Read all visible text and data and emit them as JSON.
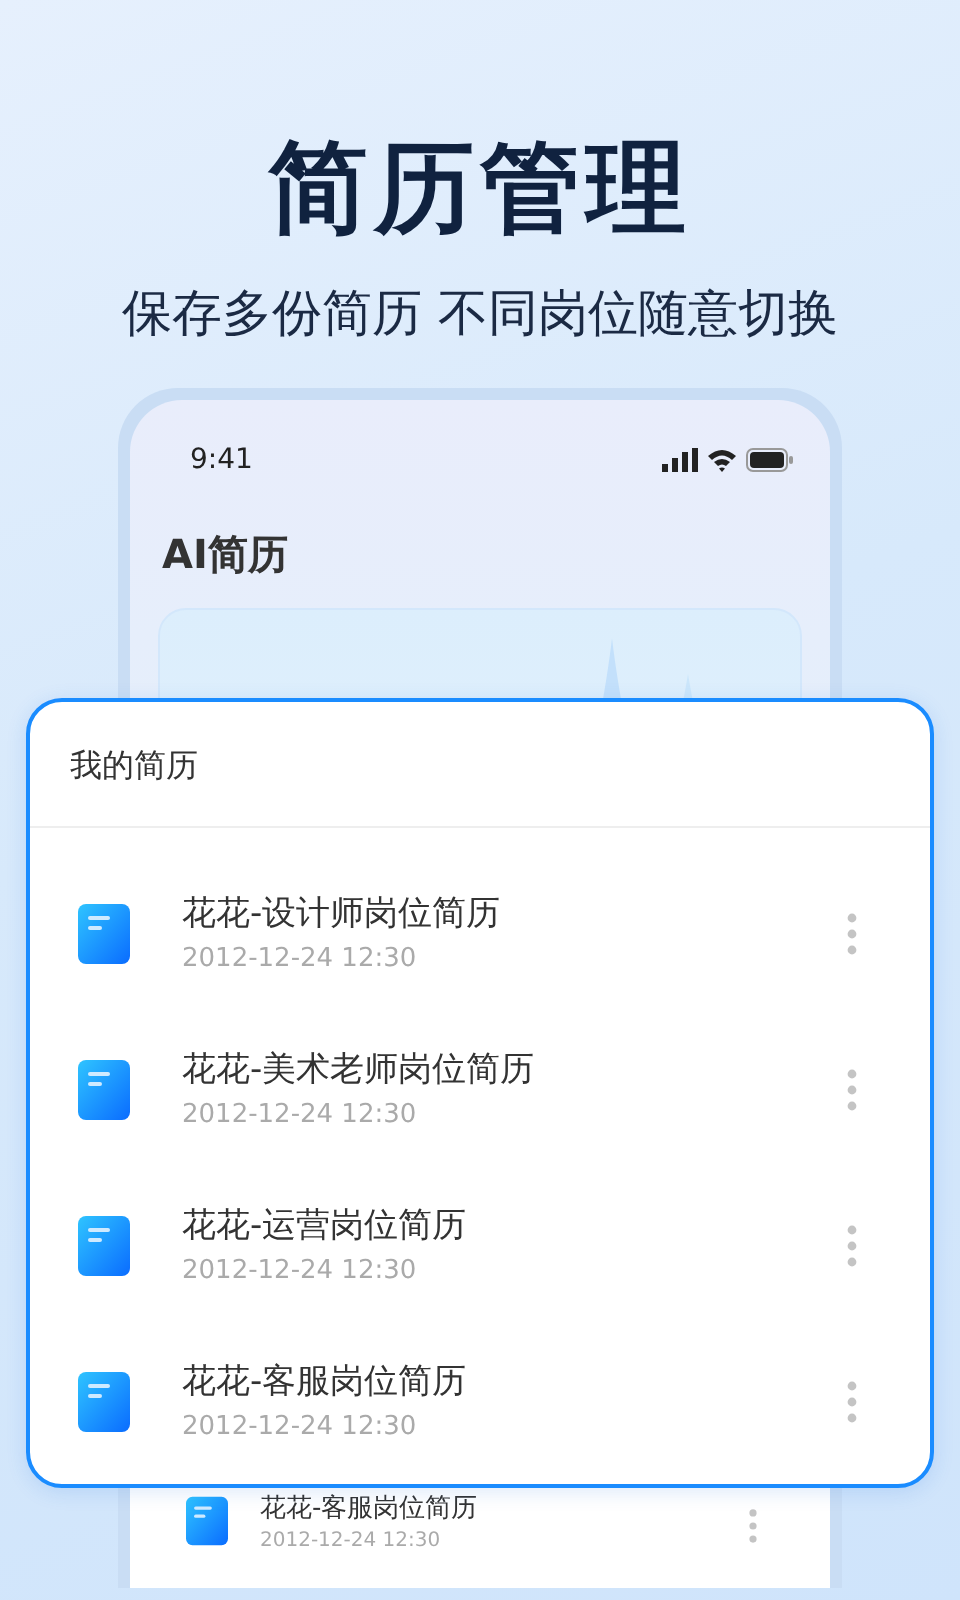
{
  "headline": "简历管理",
  "subtitle": "保存多份简历 不同岗位随意切换",
  "phone": {
    "status_bar": {
      "time": "9:41"
    },
    "app_title": "AI简历",
    "background_resumes": [
      {
        "title": "花花-客服岗位简历",
        "date": "2012-12-24 12:30"
      }
    ]
  },
  "resume_panel": {
    "title": "我的简历",
    "resumes": [
      {
        "title": "花花-设计师岗位简历",
        "date": "2012-12-24 12:30"
      },
      {
        "title": "花花-美术老师岗位简历",
        "date": "2012-12-24 12:30"
      },
      {
        "title": "花花-运营岗位简历",
        "date": "2012-12-24 12:30"
      },
      {
        "title": "花花-客服岗位简历",
        "date": "2012-12-24 12:30"
      }
    ]
  }
}
